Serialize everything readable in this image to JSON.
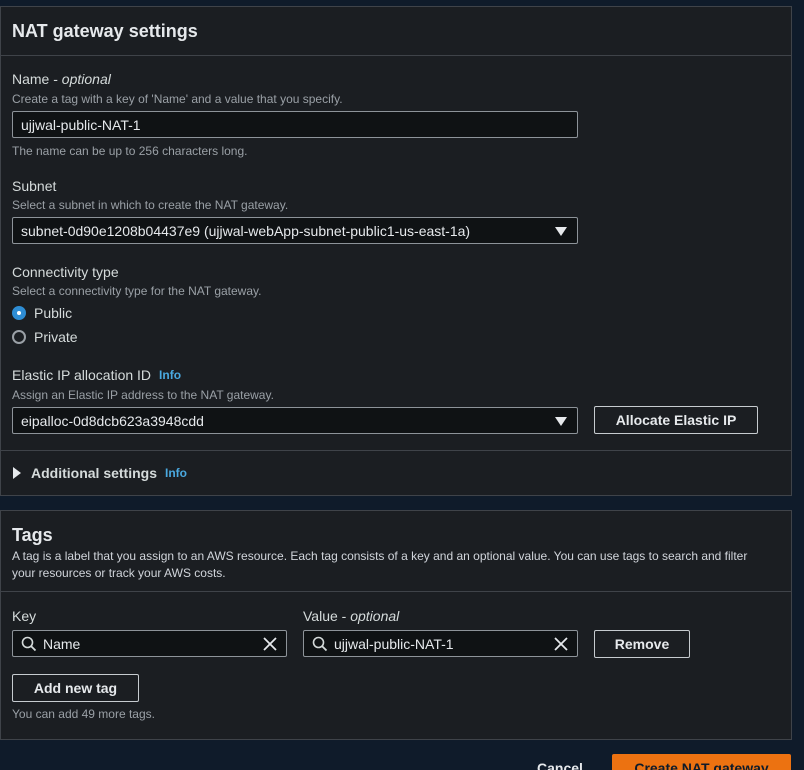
{
  "nat": {
    "title": "NAT gateway settings",
    "name_label": "Name - ",
    "name_label_optional": "optional",
    "name_desc": "Create a tag with a key of 'Name' and a value that you specify.",
    "name_value": "ujjwal-public-NAT-1",
    "name_hint": "The name can be up to 256 characters long.",
    "subnet_label": "Subnet",
    "subnet_desc": "Select a subnet in which to create the NAT gateway.",
    "subnet_value": "subnet-0d90e1208b04437e9 (ujjwal-webApp-subnet-public1-us-east-1a)",
    "connectivity_label": "Connectivity type",
    "connectivity_desc": "Select a connectivity type for the NAT gateway.",
    "connectivity_options": [
      "Public",
      "Private"
    ],
    "connectivity_selected": "Public",
    "eip_label": "Elastic IP allocation ID",
    "eip_info": "Info",
    "eip_desc": "Assign an Elastic IP address to the NAT gateway.",
    "eip_value": "eipalloc-0d8dcb623a3948cdd",
    "allocate_button": "Allocate Elastic IP",
    "additional_label": "Additional settings",
    "additional_info": "Info"
  },
  "tags": {
    "title": "Tags",
    "desc_line1": "A tag is a label that you assign to an AWS resource. Each tag consists of a key and an optional value. You can use tags to search and filter",
    "desc_line2": "your resources or track your AWS costs.",
    "key_header": "Key",
    "value_header": "Value - ",
    "value_header_optional": "optional",
    "rows": [
      {
        "key": "Name",
        "value": "ujjwal-public-NAT-1"
      }
    ],
    "remove_button": "Remove",
    "add_button": "Add new tag",
    "remaining": "You can add 49 more tags."
  },
  "footer": {
    "cancel": "Cancel",
    "create": "Create NAT gateway"
  },
  "colors": {
    "accent": "#2e8dd4",
    "primary_button": "#ec7211",
    "info_link": "#4aa9e0"
  }
}
